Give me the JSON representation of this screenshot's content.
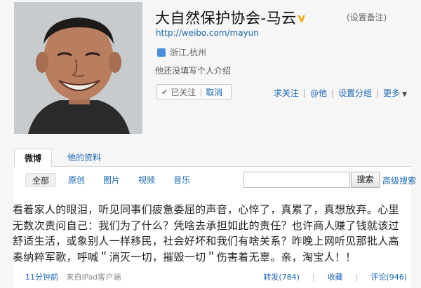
{
  "profile": {
    "name": "大自然保护协会-马云",
    "verified_icon": "verified-v-icon",
    "remark_link": "(设置备注)",
    "url": "http://weibo.com/mayun",
    "location": "浙江,杭州",
    "bio": "他还没填写个人介绍"
  },
  "follow": {
    "followed_label": "已关注",
    "cancel_label": "取消"
  },
  "actions": {
    "ask_follow": "求关注",
    "mention": "@他",
    "set_group": "设置分组",
    "more": "更多"
  },
  "tabs": [
    {
      "label": "微博"
    },
    {
      "label": "他的资料"
    }
  ],
  "filters": [
    {
      "label": "全部"
    },
    {
      "label": "原创"
    },
    {
      "label": "图片"
    },
    {
      "label": "视频"
    },
    {
      "label": "音乐"
    }
  ],
  "search": {
    "value": "",
    "button": "搜索",
    "advanced": "高级搜索"
  },
  "post": {
    "text": "看着家人的眼泪，听见同事们疲惫委屈的声音，心悴了，真累了，真想放弃。心里无数次责问自己：我们为了什么？凭啥去承担如此的责任？也许商人赚了钱就该过舒适生活，或象别人一样移民，社会好坏和我们有啥关系？昨晚上网听见那批人高奏纳粹军歌，呼喊＂消灭一切，摧毁一切＂伤害着无辜。亲，淘宝人！！",
    "time": "11分钟前",
    "source": "来自iPad客户端",
    "repost": "转发(784)",
    "favorite": "收藏",
    "comment": "评论(946)"
  },
  "colors": {
    "link": "#1a66b3",
    "background": "#f6f6f6",
    "verified": "#f1a300"
  }
}
